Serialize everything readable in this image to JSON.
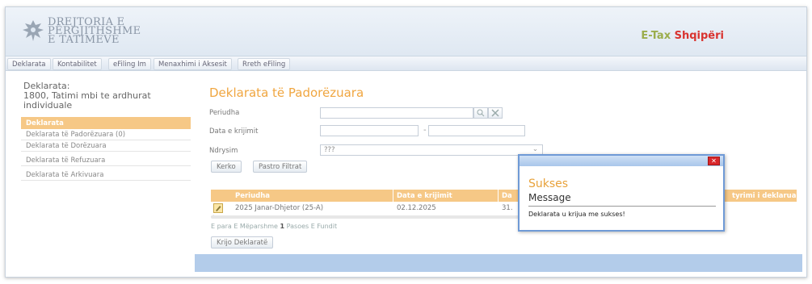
{
  "header": {
    "logo_lines": [
      "DREJTORIA E",
      "PËRGJITHSHME",
      "E TATIMEVE"
    ],
    "brand_part1": "E-Tax ",
    "brand_part2": "Shqipëri"
  },
  "nav": {
    "tabs": [
      "Deklarata",
      "Kontabilitet",
      "eFiling Im",
      "Menaxhimi i Aksesit",
      "Rreth eFiling"
    ]
  },
  "sidebar": {
    "title_lines": [
      "Deklarata:",
      "1800, Tatimi mbi te ardhurat",
      "individuale"
    ],
    "section": "Deklarata",
    "items": [
      "Deklarata të Padorëzuara (0)",
      "Deklarata të Dorëzuara",
      "Deklarata të Refuzuara",
      "Deklarata të Arkivuara"
    ]
  },
  "main": {
    "title": "Deklarata të Padorëzuara",
    "labels": {
      "period": "Periudha",
      "created": "Data e krijimit",
      "sort": "Ndrysim"
    },
    "sort_value": "???",
    "search_button": "Kerko",
    "clear_button": "Pastro Filtrat",
    "table": {
      "columns": [
        "Periudha",
        "Data e krijimit",
        "Da",
        "tyrimi i deklaruar"
      ],
      "rows": [
        {
          "period": "2025 Janar-Dhjetor (25-A)",
          "created": "02.12.2025",
          "col3": "31."
        }
      ]
    },
    "pager": {
      "first": "E para",
      "prev": "E Mëparshme",
      "current": "1",
      "next": "Pasoes",
      "last": "E Fundit"
    },
    "create_button": "Krijo Deklaratë"
  },
  "modal": {
    "close": "✕",
    "title": "Sukses",
    "subtitle": "Message",
    "message": "Deklarata u krijua me sukses!"
  },
  "colors": {
    "accent_orange": "#f6c886",
    "title_orange": "#f0a640",
    "brand_green": "#9bad4c",
    "brand_red": "#d9332f",
    "modal_border": "#6f9ad6",
    "footer_blue": "#b3ccea"
  }
}
